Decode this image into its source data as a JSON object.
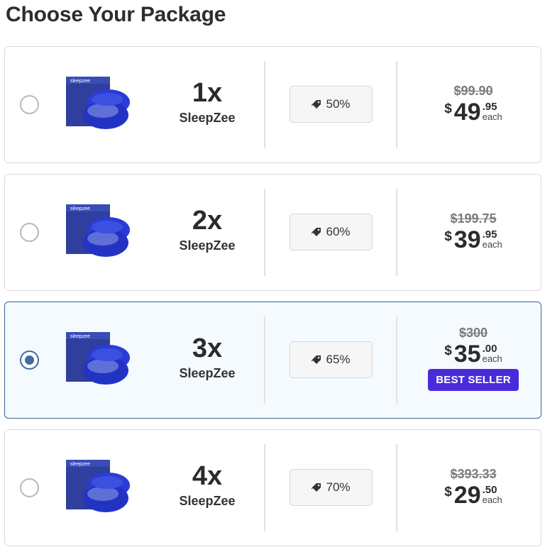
{
  "page": {
    "title": "Choose Your Package"
  },
  "packages": [
    {
      "qty": "1x",
      "name": "SleepZee",
      "discount": "50%",
      "old_price": "$99.90",
      "currency": "$",
      "whole": "49",
      "cents": ".95",
      "each": "each",
      "selected": false
    },
    {
      "qty": "2x",
      "name": "SleepZee",
      "discount": "60%",
      "old_price": "$199.75",
      "currency": "$",
      "whole": "39",
      "cents": ".95",
      "each": "each",
      "selected": false
    },
    {
      "qty": "3x",
      "name": "SleepZee",
      "discount": "65%",
      "old_price": "$300",
      "currency": "$",
      "whole": "35",
      "cents": ".00",
      "each": "each",
      "selected": true,
      "badge": "BEST SELLER"
    },
    {
      "qty": "4x",
      "name": "SleepZee",
      "discount": "70%",
      "old_price": "$393.33",
      "currency": "$",
      "whole": "29",
      "cents": ".50",
      "each": "each",
      "selected": false
    }
  ],
  "product_image": {
    "brand_text": "sleepzee"
  },
  "colors": {
    "selected_border": "#3d6491",
    "selected_bg": "#f4fafe",
    "radio_active": "#3f6d9e",
    "badge_bg": "#4b2bd9"
  },
  "icons": {
    "discount": "tags-icon"
  }
}
